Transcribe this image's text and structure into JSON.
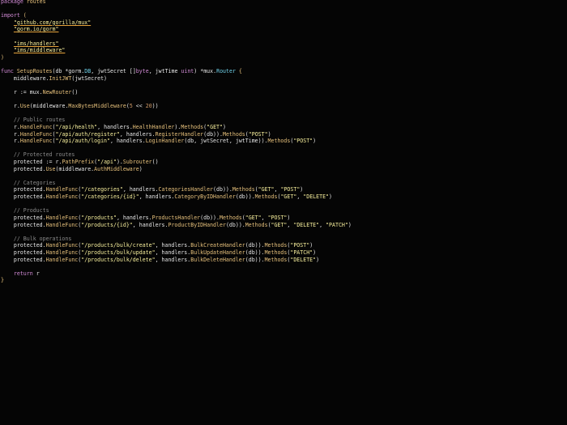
{
  "editor": {
    "background": "#050505",
    "colors": {
      "keyword": "#d28bd6",
      "function": "#e6c07b",
      "string": "#f7ef9c",
      "comment": "#8a8a8a",
      "type": "#6fd0e8",
      "number": "#d19a66",
      "text": "#e6e6e6"
    },
    "lines": [
      [
        {
          "t": "package ",
          "c": "kw"
        },
        {
          "t": "routes",
          "c": "fn"
        }
      ],
      [],
      [
        {
          "t": "import ",
          "c": "kw"
        },
        {
          "t": "(",
          "c": "br"
        }
      ],
      [
        {
          "t": "    ",
          "c": "pl"
        },
        {
          "t": "\"github.com/gorilla/mux\"",
          "c": "imp"
        }
      ],
      [
        {
          "t": "    ",
          "c": "pl"
        },
        {
          "t": "\"gorm.io/gorm\"",
          "c": "imp"
        }
      ],
      [],
      [
        {
          "t": "    ",
          "c": "pl"
        },
        {
          "t": "\"ims/handlers\"",
          "c": "imp"
        }
      ],
      [
        {
          "t": "    ",
          "c": "pl"
        },
        {
          "t": "\"ims/middleware\"",
          "c": "imp"
        }
      ],
      [
        {
          "t": ")",
          "c": "br"
        }
      ],
      [],
      [
        {
          "t": "func ",
          "c": "kw"
        },
        {
          "t": "SetupRoutes",
          "c": "fn"
        },
        {
          "t": "(db *",
          "c": "pl"
        },
        {
          "t": "gorm",
          "c": "pl"
        },
        {
          "t": ".",
          "c": "pl"
        },
        {
          "t": "DB",
          "c": "ty"
        },
        {
          "t": ", jwtSecret []",
          "c": "pl"
        },
        {
          "t": "byte",
          "c": "kw"
        },
        {
          "t": ", jwtTime ",
          "c": "pl"
        },
        {
          "t": "uint",
          "c": "kw"
        },
        {
          "t": ") *",
          "c": "pl"
        },
        {
          "t": "mux",
          "c": "pl"
        },
        {
          "t": ".",
          "c": "pl"
        },
        {
          "t": "Router",
          "c": "ty"
        },
        {
          "t": " {",
          "c": "br"
        }
      ],
      [
        {
          "t": "    middleware.",
          "c": "pl"
        },
        {
          "t": "InitJWT",
          "c": "fn"
        },
        {
          "t": "(jwtSecret)",
          "c": "pl"
        }
      ],
      [],
      [
        {
          "t": "    r := mux.",
          "c": "pl"
        },
        {
          "t": "NewRouter",
          "c": "fn"
        },
        {
          "t": "()",
          "c": "pl"
        }
      ],
      [],
      [
        {
          "t": "    r.",
          "c": "pl"
        },
        {
          "t": "Use",
          "c": "fn"
        },
        {
          "t": "(middleware.",
          "c": "pl"
        },
        {
          "t": "MaxBytesMiddleware",
          "c": "fn"
        },
        {
          "t": "(",
          "c": "pl"
        },
        {
          "t": "5",
          "c": "num"
        },
        {
          "t": " << ",
          "c": "pl"
        },
        {
          "t": "20",
          "c": "num"
        },
        {
          "t": "))",
          "c": "pl"
        }
      ],
      [],
      [
        {
          "t": "    // Public routes",
          "c": "cm"
        }
      ],
      [
        {
          "t": "    r.",
          "c": "pl"
        },
        {
          "t": "HandleFunc",
          "c": "fn"
        },
        {
          "t": "(",
          "c": "pl"
        },
        {
          "t": "\"/api/health\"",
          "c": "str"
        },
        {
          "t": ", handlers.",
          "c": "pl"
        },
        {
          "t": "HealthHandler",
          "c": "fn"
        },
        {
          "t": ").",
          "c": "pl"
        },
        {
          "t": "Methods",
          "c": "fn"
        },
        {
          "t": "(",
          "c": "pl"
        },
        {
          "t": "\"GET\"",
          "c": "str"
        },
        {
          "t": ")",
          "c": "pl"
        }
      ],
      [
        {
          "t": "    r.",
          "c": "pl"
        },
        {
          "t": "HandleFunc",
          "c": "fn"
        },
        {
          "t": "(",
          "c": "pl"
        },
        {
          "t": "\"/api/auth/register\"",
          "c": "str"
        },
        {
          "t": ", handlers.",
          "c": "pl"
        },
        {
          "t": "RegisterHandler",
          "c": "fn"
        },
        {
          "t": "(db)).",
          "c": "pl"
        },
        {
          "t": "Methods",
          "c": "fn"
        },
        {
          "t": "(",
          "c": "pl"
        },
        {
          "t": "\"POST\"",
          "c": "str"
        },
        {
          "t": ")",
          "c": "pl"
        }
      ],
      [
        {
          "t": "    r.",
          "c": "pl"
        },
        {
          "t": "HandleFunc",
          "c": "fn"
        },
        {
          "t": "(",
          "c": "pl"
        },
        {
          "t": "\"/api/auth/login\"",
          "c": "str"
        },
        {
          "t": ", handlers.",
          "c": "pl"
        },
        {
          "t": "LoginHandler",
          "c": "fn"
        },
        {
          "t": "(db, jwtSecret, jwtTime)).",
          "c": "pl"
        },
        {
          "t": "Methods",
          "c": "fn"
        },
        {
          "t": "(",
          "c": "pl"
        },
        {
          "t": "\"POST\"",
          "c": "str"
        },
        {
          "t": ")",
          "c": "pl"
        }
      ],
      [],
      [
        {
          "t": "    // Protected routes",
          "c": "cm"
        }
      ],
      [
        {
          "t": "    protected := r.",
          "c": "pl"
        },
        {
          "t": "PathPrefix",
          "c": "fn"
        },
        {
          "t": "(",
          "c": "pl"
        },
        {
          "t": "\"/api\"",
          "c": "str"
        },
        {
          "t": ").",
          "c": "pl"
        },
        {
          "t": "Subrouter",
          "c": "fn"
        },
        {
          "t": "()",
          "c": "pl"
        }
      ],
      [
        {
          "t": "    protected.",
          "c": "pl"
        },
        {
          "t": "Use",
          "c": "fn"
        },
        {
          "t": "(middleware.",
          "c": "pl"
        },
        {
          "t": "AuthMiddleware",
          "c": "fn"
        },
        {
          "t": ")",
          "c": "pl"
        }
      ],
      [],
      [
        {
          "t": "    // Categories",
          "c": "cm"
        }
      ],
      [
        {
          "t": "    protected.",
          "c": "pl"
        },
        {
          "t": "HandleFunc",
          "c": "fn"
        },
        {
          "t": "(",
          "c": "pl"
        },
        {
          "t": "\"/categories\"",
          "c": "str"
        },
        {
          "t": ", handlers.",
          "c": "pl"
        },
        {
          "t": "CategoriesHandler",
          "c": "fn"
        },
        {
          "t": "(db)).",
          "c": "pl"
        },
        {
          "t": "Methods",
          "c": "fn"
        },
        {
          "t": "(",
          "c": "pl"
        },
        {
          "t": "\"GET\"",
          "c": "str"
        },
        {
          "t": ", ",
          "c": "pl"
        },
        {
          "t": "\"POST\"",
          "c": "str"
        },
        {
          "t": ")",
          "c": "pl"
        }
      ],
      [
        {
          "t": "    protected.",
          "c": "pl"
        },
        {
          "t": "HandleFunc",
          "c": "fn"
        },
        {
          "t": "(",
          "c": "pl"
        },
        {
          "t": "\"/categories/{id}\"",
          "c": "str"
        },
        {
          "t": ", handlers.",
          "c": "pl"
        },
        {
          "t": "CategoryByIDHandler",
          "c": "fn"
        },
        {
          "t": "(db)).",
          "c": "pl"
        },
        {
          "t": "Methods",
          "c": "fn"
        },
        {
          "t": "(",
          "c": "pl"
        },
        {
          "t": "\"GET\"",
          "c": "str"
        },
        {
          "t": ", ",
          "c": "pl"
        },
        {
          "t": "\"DELETE\"",
          "c": "str"
        },
        {
          "t": ")",
          "c": "pl"
        }
      ],
      [],
      [
        {
          "t": "    // Products",
          "c": "cm"
        }
      ],
      [
        {
          "t": "    protected.",
          "c": "pl"
        },
        {
          "t": "HandleFunc",
          "c": "fn"
        },
        {
          "t": "(",
          "c": "pl"
        },
        {
          "t": "\"/products\"",
          "c": "str"
        },
        {
          "t": ", handlers.",
          "c": "pl"
        },
        {
          "t": "ProductsHandler",
          "c": "fn"
        },
        {
          "t": "(db)).",
          "c": "pl"
        },
        {
          "t": "Methods",
          "c": "fn"
        },
        {
          "t": "(",
          "c": "pl"
        },
        {
          "t": "\"GET\"",
          "c": "str"
        },
        {
          "t": ", ",
          "c": "pl"
        },
        {
          "t": "\"POST\"",
          "c": "str"
        },
        {
          "t": ")",
          "c": "pl"
        }
      ],
      [
        {
          "t": "    protected.",
          "c": "pl"
        },
        {
          "t": "HandleFunc",
          "c": "fn"
        },
        {
          "t": "(",
          "c": "pl"
        },
        {
          "t": "\"/products/{id}\"",
          "c": "str"
        },
        {
          "t": ", handlers.",
          "c": "pl"
        },
        {
          "t": "ProductByIDHandler",
          "c": "fn"
        },
        {
          "t": "(db)).",
          "c": "pl"
        },
        {
          "t": "Methods",
          "c": "fn"
        },
        {
          "t": "(",
          "c": "pl"
        },
        {
          "t": "\"GET\"",
          "c": "str"
        },
        {
          "t": ", ",
          "c": "pl"
        },
        {
          "t": "\"DELETE\"",
          "c": "str"
        },
        {
          "t": ", ",
          "c": "pl"
        },
        {
          "t": "\"PATCH\"",
          "c": "str"
        },
        {
          "t": ")",
          "c": "pl"
        }
      ],
      [],
      [
        {
          "t": "    // Bulk operations",
          "c": "cm"
        }
      ],
      [
        {
          "t": "    protected.",
          "c": "pl"
        },
        {
          "t": "HandleFunc",
          "c": "fn"
        },
        {
          "t": "(",
          "c": "pl"
        },
        {
          "t": "\"/products/bulk/create\"",
          "c": "str"
        },
        {
          "t": ", handlers.",
          "c": "pl"
        },
        {
          "t": "BulkCreateHandler",
          "c": "fn"
        },
        {
          "t": "(db)).",
          "c": "pl"
        },
        {
          "t": "Methods",
          "c": "fn"
        },
        {
          "t": "(",
          "c": "pl"
        },
        {
          "t": "\"POST\"",
          "c": "str"
        },
        {
          "t": ")",
          "c": "pl"
        }
      ],
      [
        {
          "t": "    protected.",
          "c": "pl"
        },
        {
          "t": "HandleFunc",
          "c": "fn"
        },
        {
          "t": "(",
          "c": "pl"
        },
        {
          "t": "\"/products/bulk/update\"",
          "c": "str"
        },
        {
          "t": ", handlers.",
          "c": "pl"
        },
        {
          "t": "BulkUpdateHandler",
          "c": "fn"
        },
        {
          "t": "(db)).",
          "c": "pl"
        },
        {
          "t": "Methods",
          "c": "fn"
        },
        {
          "t": "(",
          "c": "pl"
        },
        {
          "t": "\"PATCH\"",
          "c": "str"
        },
        {
          "t": ")",
          "c": "pl"
        }
      ],
      [
        {
          "t": "    protected.",
          "c": "pl"
        },
        {
          "t": "HandleFunc",
          "c": "fn"
        },
        {
          "t": "(",
          "c": "pl"
        },
        {
          "t": "\"/products/bulk/delete\"",
          "c": "str"
        },
        {
          "t": ", handlers.",
          "c": "pl"
        },
        {
          "t": "BulkDeleteHandler",
          "c": "fn"
        },
        {
          "t": "(db)).",
          "c": "pl"
        },
        {
          "t": "Methods",
          "c": "fn"
        },
        {
          "t": "(",
          "c": "pl"
        },
        {
          "t": "\"DELETE\"",
          "c": "str"
        },
        {
          "t": ")",
          "c": "pl"
        }
      ],
      [],
      [
        {
          "t": "    ",
          "c": "pl"
        },
        {
          "t": "return ",
          "c": "kw"
        },
        {
          "t": "r",
          "c": "pl"
        }
      ],
      [
        {
          "t": "}",
          "c": "br"
        }
      ]
    ]
  }
}
